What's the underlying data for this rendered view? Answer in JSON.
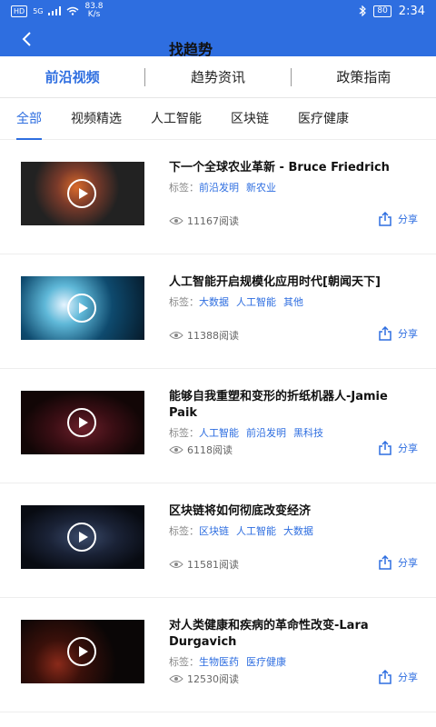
{
  "statusbar": {
    "hd": "HD",
    "signal": "5G",
    "speed_value": "83.8",
    "speed_unit": "K/s",
    "battery": "80",
    "time": "2:34"
  },
  "header": {
    "title": "找趋势"
  },
  "main_tabs": [
    {
      "label": "前沿视频"
    },
    {
      "label": "趋势资讯"
    },
    {
      "label": "政策指南"
    }
  ],
  "category_tabs": [
    {
      "label": "全部"
    },
    {
      "label": "视频精选"
    },
    {
      "label": "人工智能"
    },
    {
      "label": "区块链"
    },
    {
      "label": "医疗健康"
    }
  ],
  "tag_prefix": "标签：",
  "share_label": "分享",
  "items": [
    {
      "title": "下一个全球农业革新 - Bruce Friedrich",
      "tags": [
        "前沿发明",
        "新农业"
      ],
      "reads": "11167阅读"
    },
    {
      "title": "人工智能开启规模化应用时代[朝闻天下]",
      "tags": [
        "大数据",
        "人工智能",
        "其他"
      ],
      "reads": "11388阅读"
    },
    {
      "title": "能够自我重塑和变形的折纸机器人-Jamie Paik",
      "tags": [
        "人工智能",
        "前沿发明",
        "黑科技"
      ],
      "reads": "6118阅读"
    },
    {
      "title": "区块链将如何彻底改变经济",
      "tags": [
        "区块链",
        "人工智能",
        "大数据"
      ],
      "reads": "11581阅读"
    },
    {
      "title": "对人类健康和疾病的革命性改变-Lara Durgavich",
      "tags": [
        "生物医药",
        "医疗健康"
      ],
      "reads": "12530阅读"
    }
  ]
}
